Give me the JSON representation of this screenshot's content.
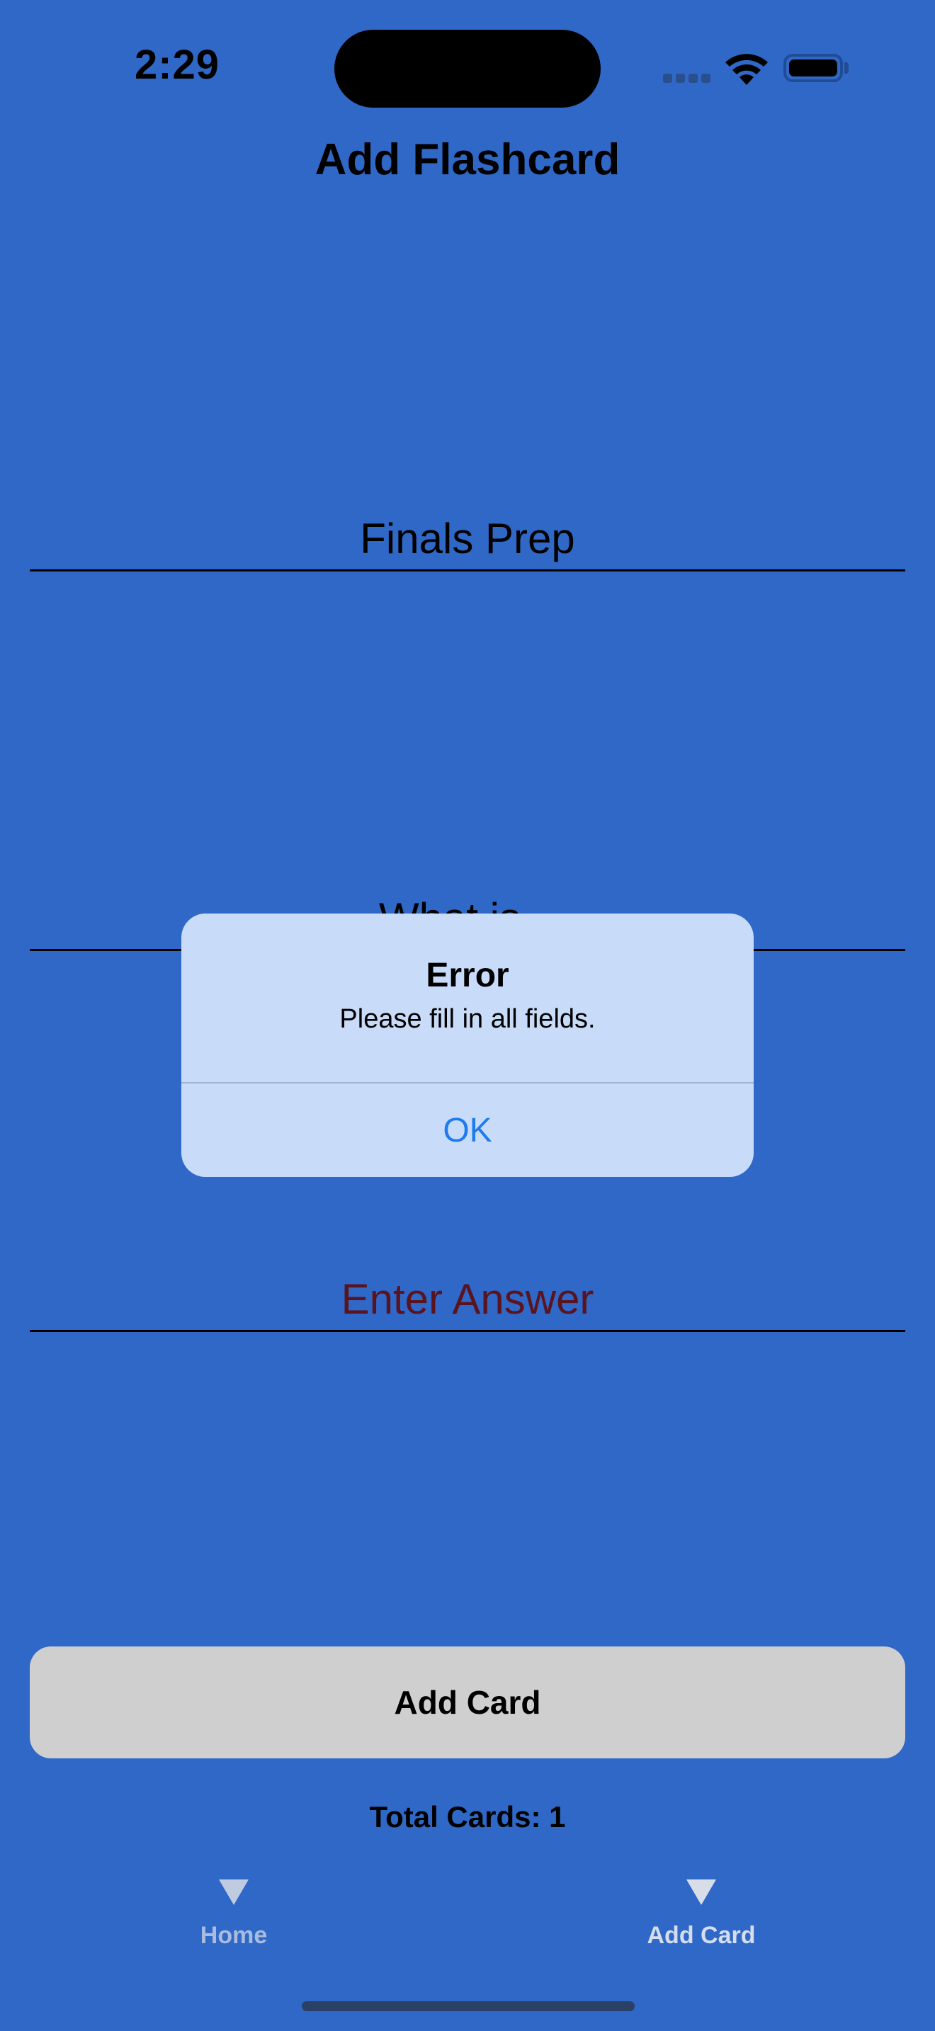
{
  "status_bar": {
    "time": "2:29",
    "wifi_icon": "wifi-icon",
    "battery_icon": "battery-icon",
    "signal_icon": "cellular-signal-icon"
  },
  "nav": {
    "title": "Add Flashcard"
  },
  "form": {
    "deck_field": {
      "value": "Finals Prep"
    },
    "question_field": {
      "value": "What is..."
    },
    "answer_field": {
      "value": "",
      "placeholder": "Enter Answer"
    }
  },
  "add_card_button": {
    "label": "Add Card"
  },
  "total_cards": {
    "text": "Total Cards: 1"
  },
  "tab_bar": {
    "items": [
      {
        "label": "Home",
        "icon": "triangle-down-icon",
        "selected": false
      },
      {
        "label": "Add Card",
        "icon": "triangle-down-icon",
        "selected": true
      }
    ]
  },
  "alert": {
    "title": "Error",
    "message": "Please fill in all fields.",
    "ok_label": "OK"
  },
  "colors": {
    "background": "#3068C7",
    "alert_background": "#C8DCFA",
    "alert_button": "#1E7BEF",
    "button_background": "#CFCFCF"
  }
}
